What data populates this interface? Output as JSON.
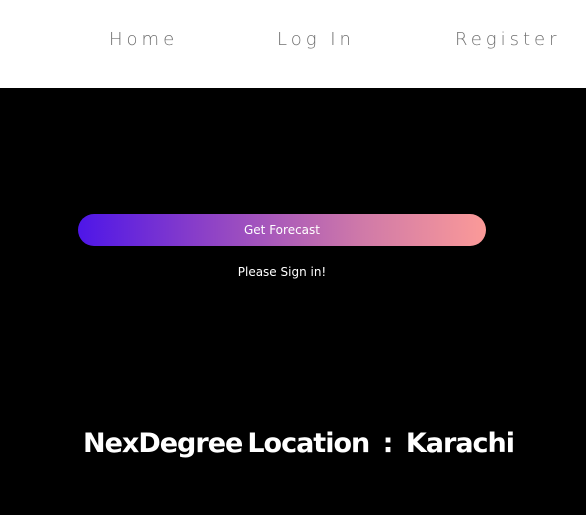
{
  "nav": {
    "home": "Home",
    "login": "Log In",
    "register": "Register"
  },
  "main": {
    "forecast_button": "Get Forecast",
    "signin_message": "Please Sign in!",
    "brand": "NexDegree",
    "location_label": "Location",
    "separator": ":",
    "location_value": "Karachi"
  },
  "colors": {
    "nav_background": "#ffffff",
    "page_background": "#000000",
    "gradient_start": "#4e16e8",
    "gradient_end": "#fb9a98"
  }
}
